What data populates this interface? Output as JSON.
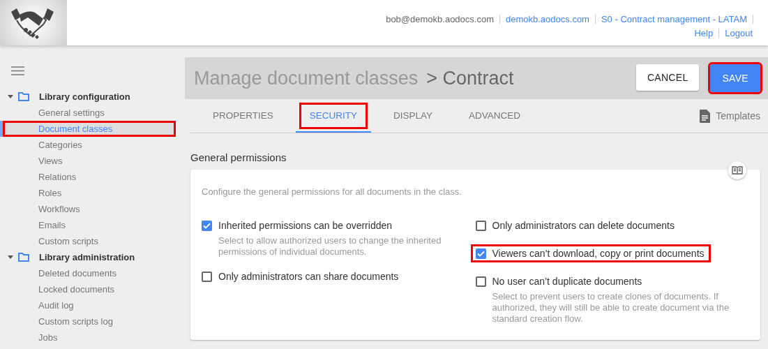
{
  "header": {
    "user": "bob@demokb.aodocs.com",
    "links": [
      {
        "label": "demokb.aodocs.com"
      },
      {
        "label": "S0 - Contract management - LATAM"
      }
    ],
    "secondary_links": [
      {
        "label": "Help"
      },
      {
        "label": "Logout"
      }
    ]
  },
  "sidebar": {
    "groups": [
      {
        "label": "Library configuration",
        "expanded": true,
        "items": [
          {
            "label": "General settings",
            "selected": false,
            "highlighted": false
          },
          {
            "label": "Document classes",
            "selected": true,
            "highlighted": true
          },
          {
            "label": "Categories",
            "selected": false,
            "highlighted": false
          },
          {
            "label": "Views",
            "selected": false,
            "highlighted": false
          },
          {
            "label": "Relations",
            "selected": false,
            "highlighted": false
          },
          {
            "label": "Roles",
            "selected": false,
            "highlighted": false
          },
          {
            "label": "Workflows",
            "selected": false,
            "highlighted": false
          },
          {
            "label": "Emails",
            "selected": false,
            "highlighted": false
          },
          {
            "label": "Custom scripts",
            "selected": false,
            "highlighted": false
          }
        ]
      },
      {
        "label": "Library administration",
        "expanded": true,
        "items": [
          {
            "label": "Deleted documents",
            "selected": false,
            "highlighted": false
          },
          {
            "label": "Locked documents",
            "selected": false,
            "highlighted": false
          },
          {
            "label": "Audit log",
            "selected": false,
            "highlighted": false
          },
          {
            "label": "Custom scripts log",
            "selected": false,
            "highlighted": false
          },
          {
            "label": "Jobs",
            "selected": false,
            "highlighted": false
          }
        ]
      }
    ]
  },
  "page": {
    "title": "Manage document classes",
    "subtitle": "> Contract",
    "buttons": [
      {
        "label": "CANCEL",
        "kind": "secondary",
        "highlighted": false
      },
      {
        "label": "SAVE",
        "kind": "primary",
        "highlighted": true
      }
    ],
    "tabs": [
      {
        "label": "PROPERTIES",
        "selected": false,
        "highlighted": false
      },
      {
        "label": "SECURITY",
        "selected": true,
        "highlighted": true
      },
      {
        "label": "DISPLAY",
        "selected": false,
        "highlighted": false
      },
      {
        "label": "ADVANCED",
        "selected": false,
        "highlighted": false
      }
    ],
    "templates_link": "Templates",
    "section": {
      "title": "General permissions",
      "description": "Configure the general permissions for all documents in the class.",
      "columns": [
        [
          {
            "label": "Inherited permissions can be overridden",
            "checked": true,
            "highlighted": false,
            "help": "Select to allow authorized users to change the inherited permissions of individual documents."
          },
          {
            "label": "Only administrators can share documents",
            "checked": false,
            "highlighted": false
          }
        ],
        [
          {
            "label": "Only administrators can delete documents",
            "checked": false,
            "highlighted": false
          },
          {
            "label": "Viewers can’t download, copy or print documents",
            "checked": true,
            "highlighted": true
          },
          {
            "label": "No user can’t duplicate documents",
            "checked": false,
            "highlighted": false,
            "help": "Select to prevent users to create clones of documents. If authorized, they will still be able to create document via the standard creation flow."
          }
        ]
      ]
    }
  }
}
